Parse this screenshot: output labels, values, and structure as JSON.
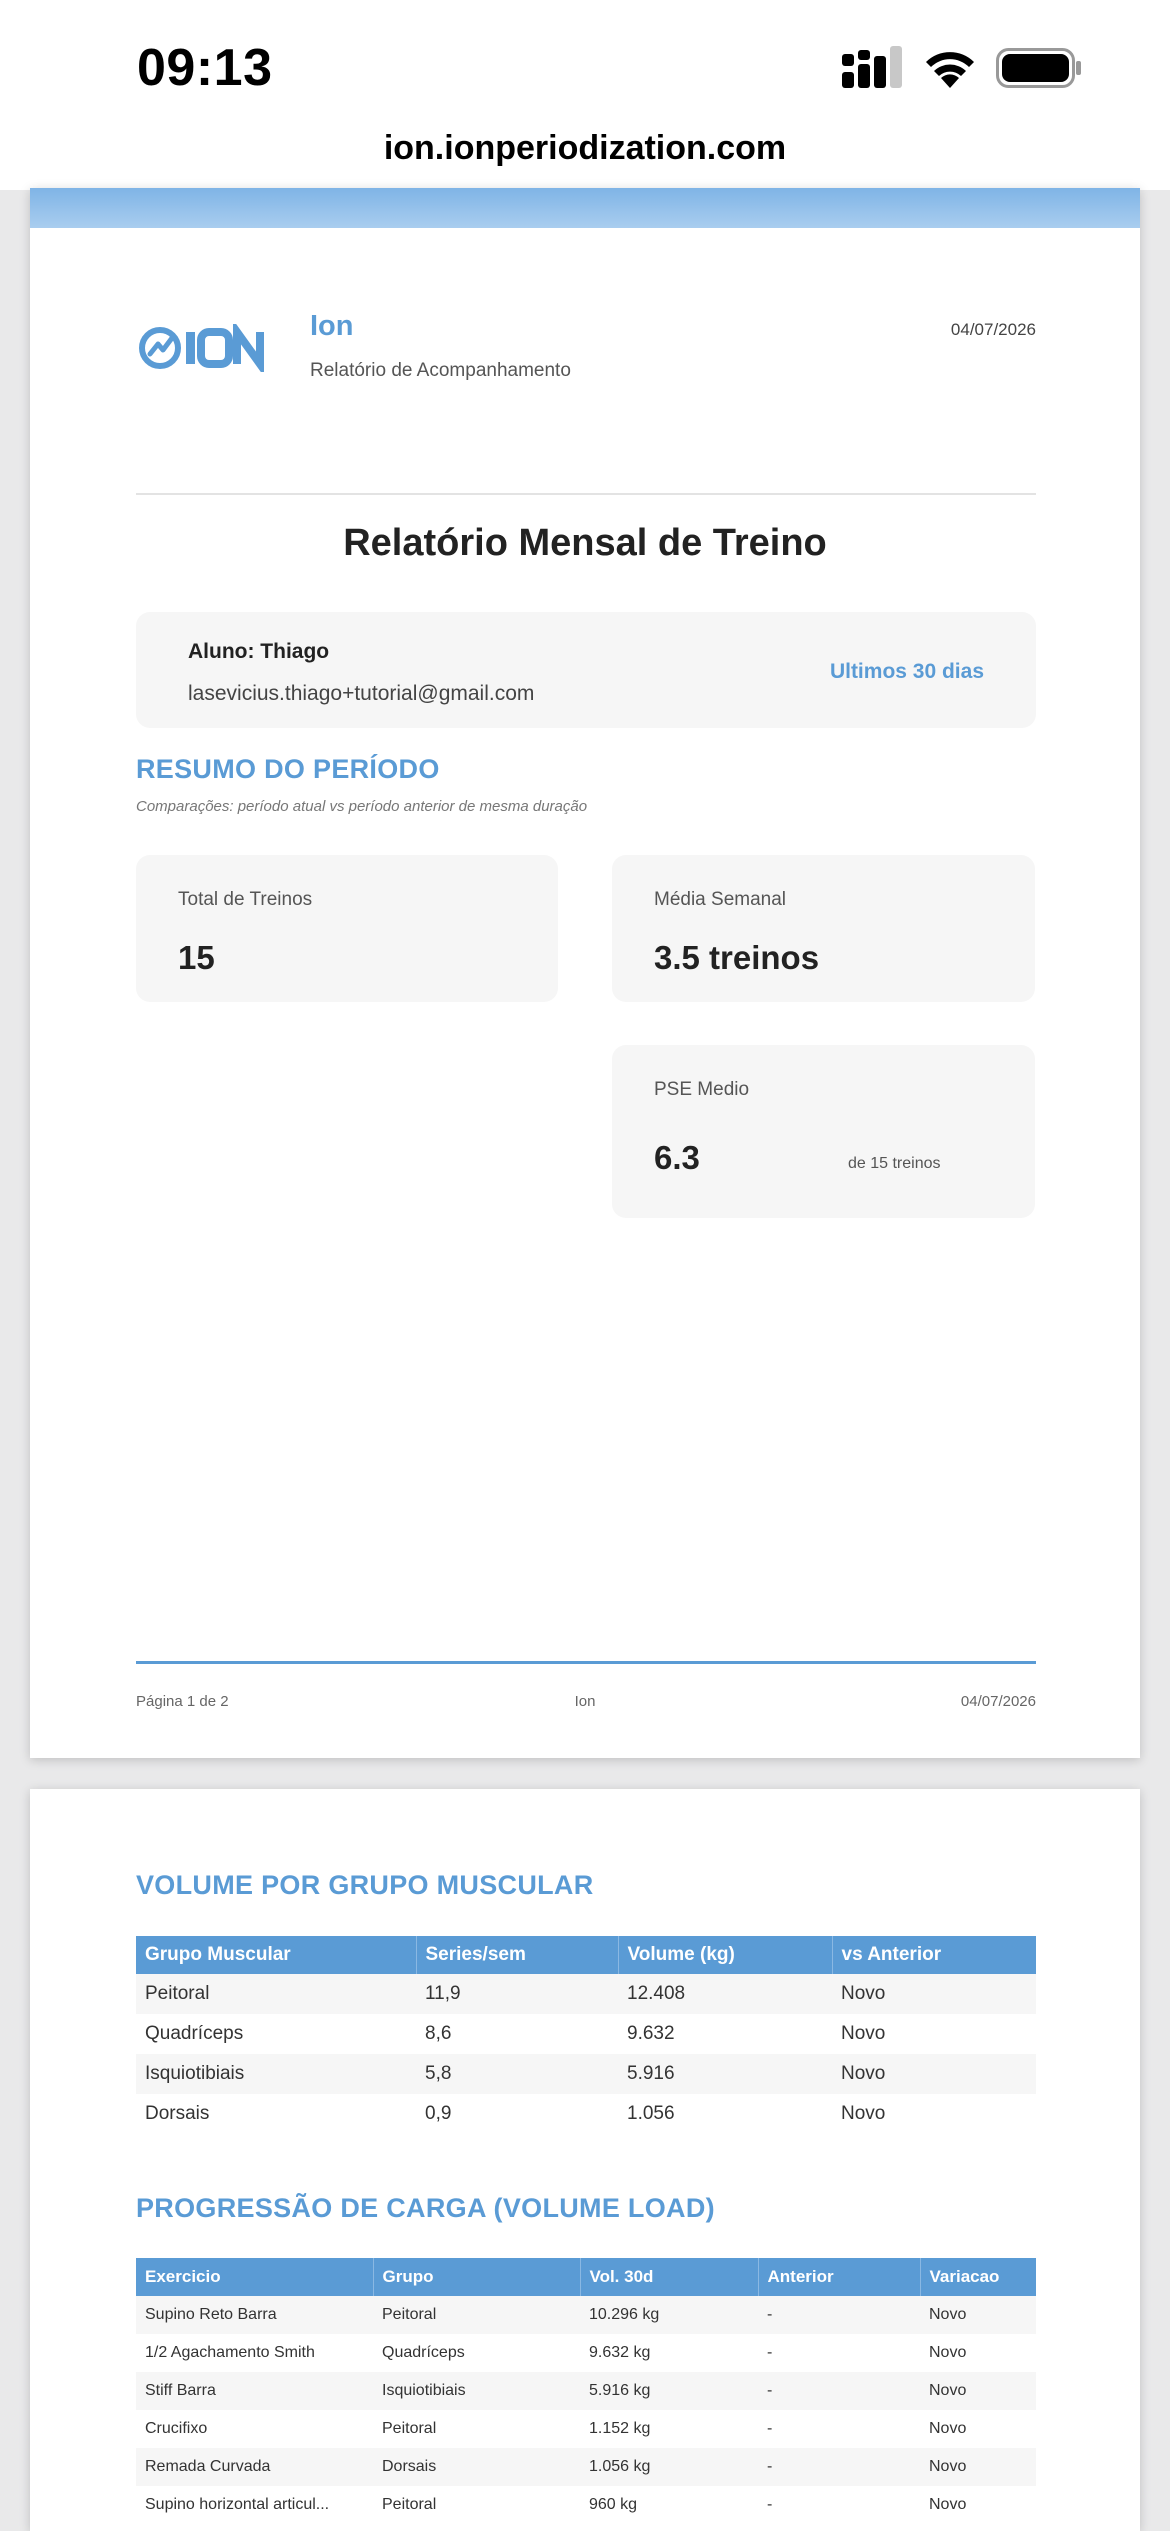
{
  "status_bar": {
    "time": "09:13"
  },
  "browser": {
    "url": "ion.ionperiodization.com"
  },
  "report_header": {
    "brand": "Ion",
    "subtitle": "Relatório de Acompanhamento",
    "date": "04/07/2026"
  },
  "report_title": "Relatório Mensal de Treino",
  "student": {
    "name": "Aluno: Thiago",
    "email": "lasevicius.thiago+tutorial@gmail.com",
    "period": "Ultimos 30 dias"
  },
  "summary": {
    "title": "RESUMO DO PERÍODO",
    "note": "Comparações: período atual vs período anterior de mesma duração",
    "total_label": "Total de Treinos",
    "total_value": "15",
    "weekly_label": "Média Semanal",
    "weekly_value": "3.5 treinos",
    "pse_label": "PSE Medio",
    "pse_value": "6.3",
    "pse_extra": "de 15 treinos"
  },
  "footer": {
    "page": "Página 1 de 2",
    "brand": "Ion",
    "date": "04/07/2026"
  },
  "volume_section": {
    "title": "VOLUME POR GRUPO MUSCULAR",
    "headers": [
      "Grupo Muscular",
      "Series/sem",
      "Volume (kg)",
      "vs Anterior"
    ],
    "rows": [
      [
        "Peitoral",
        "11,9",
        "12.408",
        "Novo"
      ],
      [
        "Quadríceps",
        "8,6",
        "9.632",
        "Novo"
      ],
      [
        "Isquiotibiais",
        "5,8",
        "5.916",
        "Novo"
      ],
      [
        "Dorsais",
        "0,9",
        "1.056",
        "Novo"
      ]
    ]
  },
  "load_section": {
    "title": "PROGRESSÃO DE CARGA (VOLUME LOAD)",
    "headers": [
      "Exercicio",
      "Grupo",
      "Vol. 30d",
      "Anterior",
      "Variacao"
    ],
    "rows": [
      [
        "Supino Reto Barra",
        "Peitoral",
        "10.296 kg",
        "-",
        "Novo"
      ],
      [
        "1/2 Agachamento Smith",
        "Quadríceps",
        "9.632 kg",
        "-",
        "Novo"
      ],
      [
        "Stiff Barra",
        "Isquiotibiais",
        "5.916 kg",
        "-",
        "Novo"
      ],
      [
        "Crucifixo",
        "Peitoral",
        "1.152 kg",
        "-",
        "Novo"
      ],
      [
        "Remada Curvada",
        "Dorsais",
        "1.056 kg",
        "-",
        "Novo"
      ],
      [
        "Supino horizontal articul...",
        "Peitoral",
        "960 kg",
        "-",
        "Novo"
      ]
    ]
  },
  "colors": {
    "accent": "#5a9bd5",
    "card_bg": "#f6f6f6"
  }
}
